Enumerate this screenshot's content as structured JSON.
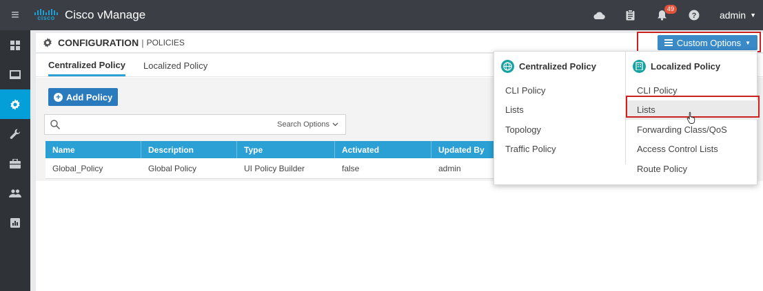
{
  "app": {
    "title": "Cisco vManage",
    "logo_word": "cisco"
  },
  "topbar": {
    "notification_count": "49",
    "user": "admin"
  },
  "header": {
    "section": "CONFIGURATION",
    "separator": "|",
    "page": "POLICIES",
    "custom_options_label": "Custom Options"
  },
  "tabs": [
    {
      "label": "Centralized Policy",
      "active": true
    },
    {
      "label": "Localized Policy",
      "active": false
    }
  ],
  "actions": {
    "add_policy_label": "Add Policy"
  },
  "search": {
    "placeholder": "",
    "options_label": "Search Options"
  },
  "table": {
    "columns": [
      "Name",
      "Description",
      "Type",
      "Activated",
      "Updated By"
    ],
    "rows": [
      {
        "name": "Global_Policy",
        "description": "Global Policy",
        "type": "UI Policy Builder",
        "activated": "false",
        "updated_by": "admin"
      }
    ]
  },
  "dropdown": {
    "centralized": {
      "title": "Centralized Policy",
      "items": [
        "CLI Policy",
        "Lists",
        "Topology",
        "Traffic Policy"
      ]
    },
    "localized": {
      "title": "Localized Policy",
      "items": [
        "CLI Policy",
        "Lists",
        "Forwarding Class/QoS",
        "Access Control Lists",
        "Route Policy"
      ]
    }
  },
  "colors": {
    "accent": "#2aa0d4",
    "topbar": "#3b3f45",
    "sidenav": "#2f3338",
    "highlight": "#cc1f1f"
  }
}
